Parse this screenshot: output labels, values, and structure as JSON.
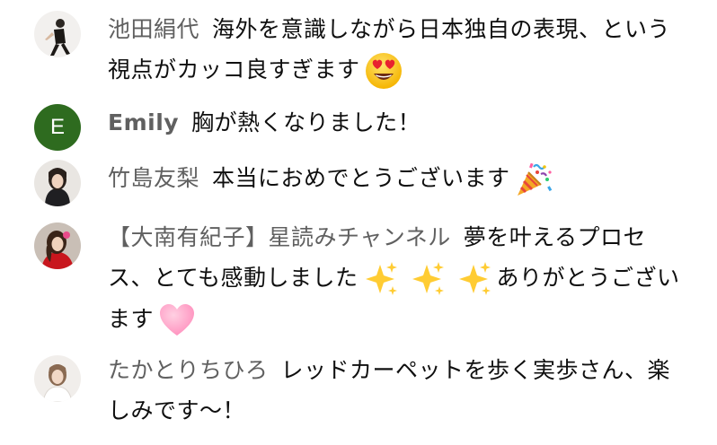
{
  "comments": [
    {
      "author": "池田絹代",
      "text": "海外を意識しながら日本独自の表現、という視点がカッコ良すぎます",
      "emoji": "heart-eyes-emoji"
    },
    {
      "author": "Emily",
      "avatar_letter": "E",
      "avatar_color": "#2e6b1f",
      "text": "胸が熱くなりました！"
    },
    {
      "author": "竹島友梨",
      "text": "本当におめでとうございます",
      "emoji": "party-popper-emoji"
    },
    {
      "author": "【大南有紀子】星読みチャンネル",
      "text_before": "夢を叶えるプロセス、とても感動しました",
      "emoji": "sparkles-emoji",
      "text_after": "ありがとうございます",
      "emoji_end": "pink-heart-emoji"
    },
    {
      "author": "たかとりちひろ",
      "text": "レッドカーペットを歩く実歩さん、楽しみです〜！"
    }
  ],
  "colors": {
    "author": "#606060",
    "text": "#0f0f0f",
    "background": "#ffffff"
  }
}
